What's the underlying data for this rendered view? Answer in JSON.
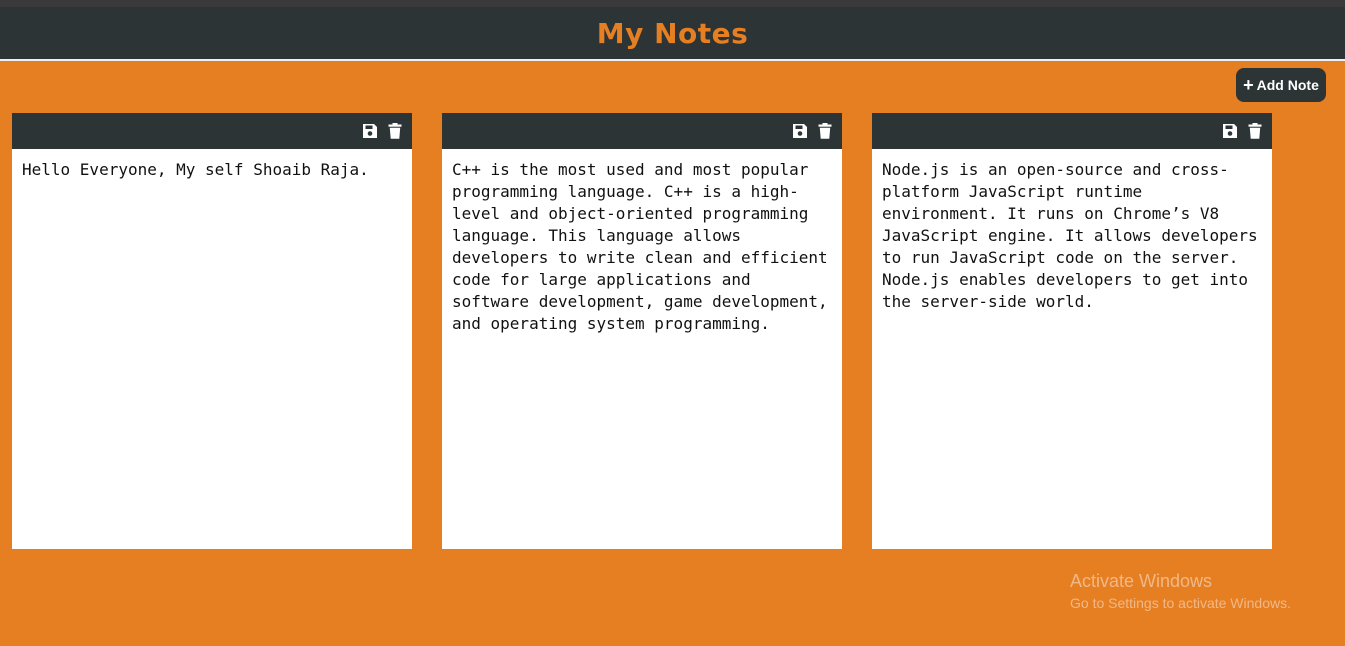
{
  "header": {
    "title": "My Notes"
  },
  "toolbar": {
    "add_label": "Add Note",
    "add_icon": "+"
  },
  "notes": [
    {
      "text": "Hello Everyone, My self Shoaib Raja.",
      "save_icon": "save-icon",
      "delete_icon": "trash-icon"
    },
    {
      "text": "C++ is the most used and most popular programming language. C++ is a high-level and object-oriented programming language. This language allows developers to write clean and efficient code for large applications and software development, game development, and operating system programming.",
      "save_icon": "save-icon",
      "delete_icon": "trash-icon"
    },
    {
      "text": "Node.js is an open-source and cross-platform JavaScript runtime environment. It runs on Chrome’s V8 JavaScript engine. It allows developers to run JavaScript code on the server. Node.js enables developers to get into the server-side world.",
      "save_icon": "save-icon",
      "delete_icon": "trash-icon"
    }
  ],
  "watermark": {
    "line1": "Activate Windows",
    "line2": "Go to Settings to activate Windows."
  },
  "colors": {
    "background": "#e67e22",
    "bar": "#2d3436",
    "accent": "#e67e22",
    "note": "#ffffff"
  }
}
